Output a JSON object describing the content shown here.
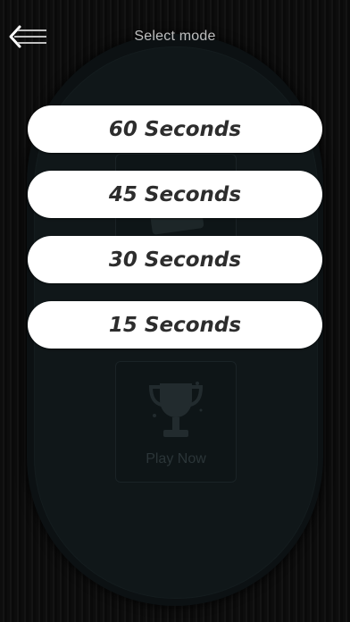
{
  "header": {
    "title": "Select mode"
  },
  "modes": [
    {
      "label": "60 Seconds"
    },
    {
      "label": "45 Seconds"
    },
    {
      "label": "30 Seconds"
    },
    {
      "label": "15 Seconds"
    }
  ],
  "background": {
    "play_now_label": "Play Now"
  },
  "icons": {
    "back": "back-arrow-icon",
    "trophy": "trophy-icon"
  },
  "colors": {
    "button_bg": "#ffffff",
    "button_text": "#2d2d2d",
    "title_text": "#bfbfbf",
    "table": "#101719"
  }
}
